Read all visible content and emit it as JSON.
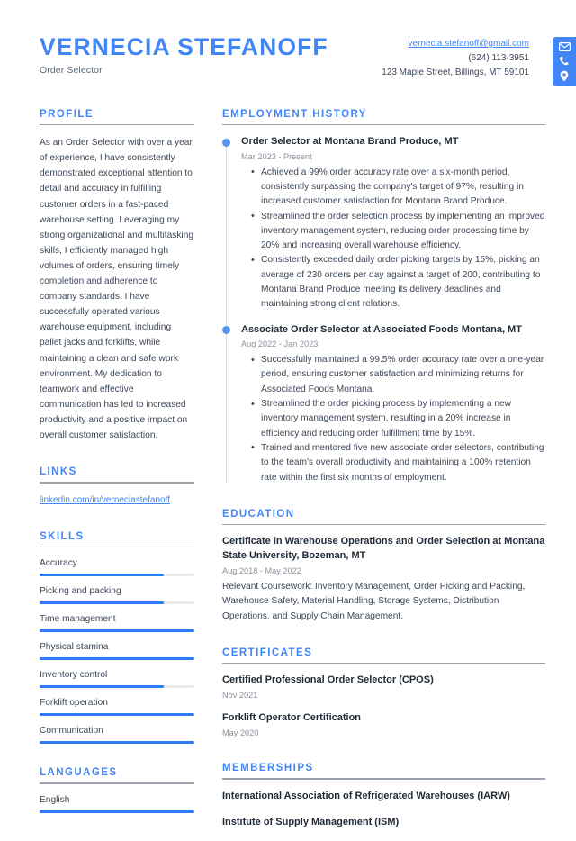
{
  "header": {
    "full_name": "VERNECIA STEFANOFF",
    "job_title": "Order Selector",
    "contact": {
      "email": "vernecia.stefanoff@gmail.com",
      "phone": "(624) 113-3951",
      "address": "123 Maple Street, Billings, MT 59101"
    },
    "icons": [
      "envelope-icon",
      "phone-icon",
      "location-pin-icon"
    ]
  },
  "sidebar": {
    "profile": {
      "title": "Profile",
      "text": "As an Order Selector with over a year of experience, I have consistently demonstrated exceptional attention to detail and accuracy in fulfilling customer orders in a fast-paced warehouse setting. Leveraging my strong organizational and multitasking skills, I efficiently managed high volumes of orders, ensuring timely completion and adherence to company standards. I have successfully operated various warehouse equipment, including pallet jacks and forklifts, while maintaining a clean and safe work environment. My dedication to teamwork and effective communication has led to increased productivity and a positive impact on overall customer satisfaction."
    },
    "links": {
      "title": "Links",
      "items": [
        {
          "label": "linkedin.com/in/verneciastefanoff"
        }
      ]
    },
    "skills": {
      "title": "Skills",
      "items": [
        {
          "label": "Accuracy",
          "level": 80
        },
        {
          "label": "Picking and packing",
          "level": 80
        },
        {
          "label": "Time management",
          "level": 100
        },
        {
          "label": "Physical stamina",
          "level": 100
        },
        {
          "label": "Inventory control",
          "level": 80
        },
        {
          "label": "Forklift operation",
          "level": 100
        },
        {
          "label": "Communication",
          "level": 100
        }
      ]
    },
    "languages": {
      "title": "Languages",
      "items": [
        {
          "label": "English",
          "level": 100
        }
      ]
    }
  },
  "main": {
    "employment": {
      "title": "Employment History",
      "jobs": [
        {
          "heading": "Order Selector at Montana Brand Produce, MT",
          "date": "Mar 2023 - Present",
          "bullets": [
            "Achieved a 99% order accuracy rate over a six-month period, consistently surpassing the company's target of 97%, resulting in increased customer satisfaction for Montana Brand Produce.",
            "Streamlined the order selection process by implementing an improved inventory management system, reducing order processing time by 20% and increasing overall warehouse efficiency.",
            "Consistently exceeded daily order picking targets by 15%, picking an average of 230 orders per day against a target of 200, contributing to Montana Brand Produce meeting its delivery deadlines and maintaining strong client relations."
          ]
        },
        {
          "heading": "Associate Order Selector at Associated Foods Montana, MT",
          "date": "Aug 2022 - Jan 2023",
          "bullets": [
            "Successfully maintained a 99.5% order accuracy rate over a one-year period, ensuring customer satisfaction and minimizing returns for Associated Foods Montana.",
            "Streamlined the order picking process by implementing a new inventory management system, resulting in a 20% increase in efficiency and reducing order fulfillment time by 15%.",
            "Trained and mentored five new associate order selectors, contributing to the team's overall productivity and maintaining a 100% retention rate within the first six months of employment."
          ]
        }
      ]
    },
    "education": {
      "title": "Education",
      "entries": [
        {
          "heading": "Certificate in Warehouse Operations and Order Selection at Montana State University, Bozeman, MT",
          "date": "Aug 2018 - May 2022",
          "description": "Relevant Coursework: Inventory Management, Order Picking and Packing, Warehouse Safety, Material Handling, Storage Systems, Distribution Operations, and Supply Chain Management."
        }
      ]
    },
    "certificates": {
      "title": "Certificates",
      "entries": [
        {
          "heading": "Certified Professional Order Selector (CPOS)",
          "date": "Nov 2021"
        },
        {
          "heading": "Forklift Operator Certification",
          "date": "May 2020"
        }
      ]
    },
    "memberships": {
      "title": "Memberships",
      "items": [
        {
          "label": "International Association of Refrigerated Warehouses (IARW)"
        },
        {
          "label": "Institute of Supply Management (ISM)"
        }
      ]
    }
  },
  "colors": {
    "accent": "#4285f4",
    "skill_fill": "#2f7bf6",
    "skill_track": "#e9eaec",
    "rule": "#9aa3ad",
    "text": "#3c4858",
    "heading_text": "#1f2a37",
    "muted_text": "#8a929c"
  }
}
